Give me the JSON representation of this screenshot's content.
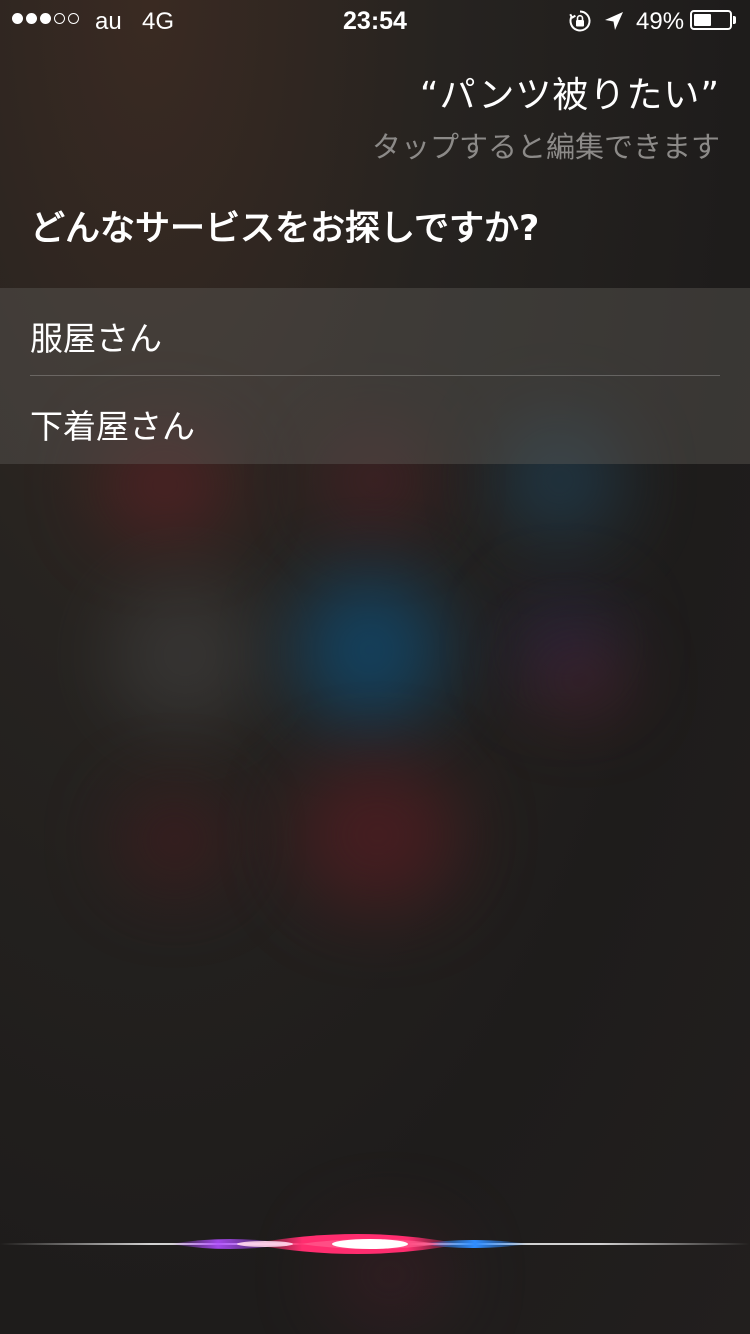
{
  "status_bar": {
    "signal_bars": 5,
    "signal_filled": 3,
    "carrier": "au",
    "network": "4G",
    "time": "23:54",
    "battery_percent_text": "49%",
    "battery_level": 0.49,
    "icons": [
      "rotation-lock-icon",
      "location-arrow-icon",
      "battery-icon"
    ]
  },
  "siri": {
    "utterance": "“パンツ被りたい”",
    "edit_hint": "タップすると編集できます",
    "question": "どんなサービスをお探しですか?",
    "options": [
      {
        "label": "服屋さん"
      },
      {
        "label": "下着屋さん"
      }
    ]
  },
  "colors": {
    "text_primary": "#ffffff",
    "text_secondary": "#8c8a88",
    "wave_pink": "#ff3b6b",
    "wave_blue": "#2f8cff",
    "wave_purple": "#b04cff"
  }
}
